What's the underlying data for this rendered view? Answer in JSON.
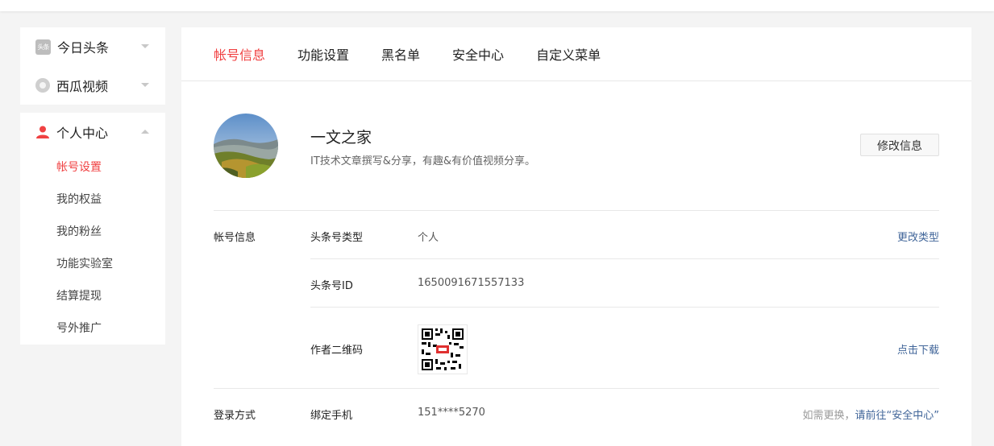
{
  "sidebar": {
    "top_items": [
      {
        "label": "今日头条",
        "icon": "toutiao-logo-icon",
        "icon_text": "头条"
      },
      {
        "label": "西瓜视频",
        "icon": "xigua-video-icon"
      }
    ],
    "personal": {
      "label": "个人中心",
      "icon": "user-icon",
      "sub_items": [
        "帐号设置",
        "我的权益",
        "我的粉丝",
        "功能实验室",
        "结算提现",
        "号外推广"
      ],
      "active_sub": "帐号设置"
    }
  },
  "tabs": [
    "帐号信息",
    "功能设置",
    "黑名单",
    "安全中心",
    "自定义菜单"
  ],
  "active_tab": "帐号信息",
  "profile": {
    "name": "一文之家",
    "description": "IT技术文章撰写&分享，有趣&有价值视频分享。",
    "edit_label": "修改信息"
  },
  "account_info": {
    "section_title": "帐号信息",
    "rows": [
      {
        "label": "头条号类型",
        "value": "个人",
        "action": "更改类型"
      },
      {
        "label": "头条号ID",
        "value": "1650091671557133"
      },
      {
        "label": "作者二维码",
        "qr": "qr-code-image",
        "action": "点击下载"
      }
    ]
  },
  "login": {
    "section_title": "登录方式",
    "label": "绑定手机",
    "value": "151****5270",
    "hint": "如需更换，",
    "link": "请前往“安全中心”"
  },
  "colors": {
    "accent": "#f04142",
    "link": "#406599",
    "background": "#f4f4f4"
  }
}
